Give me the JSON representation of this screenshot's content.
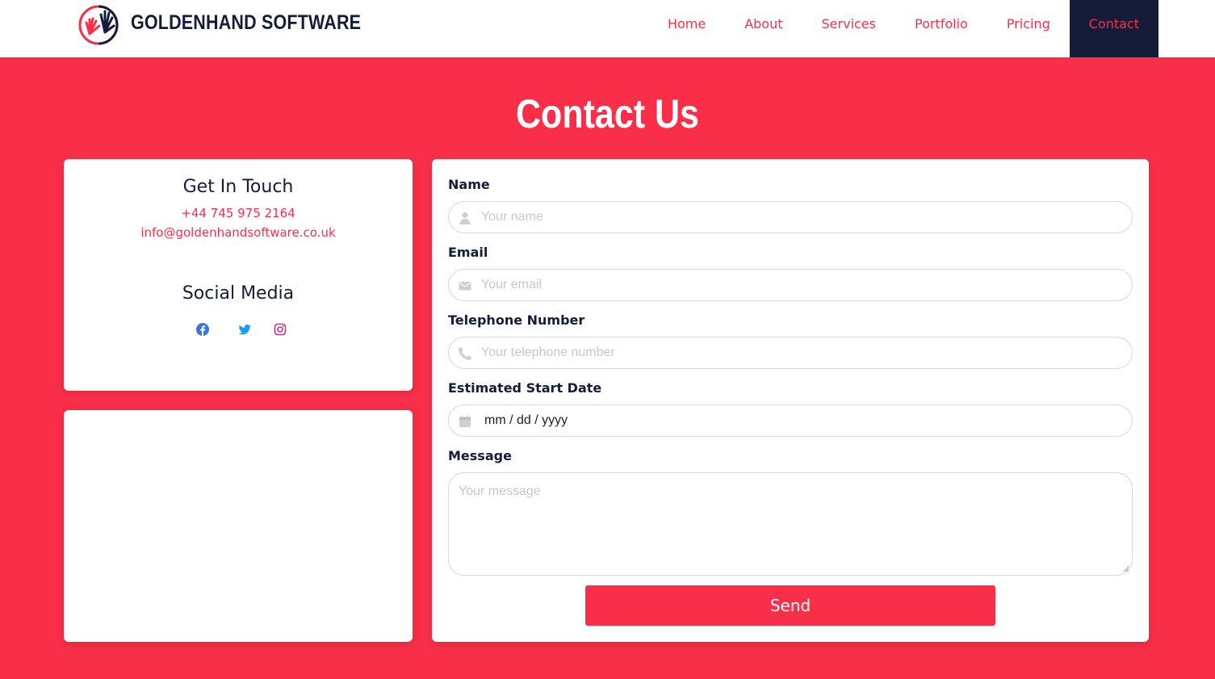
{
  "header": {
    "brand": "GOLDENHAND SOFTWARE",
    "nav": [
      {
        "label": "Home"
      },
      {
        "label": "About"
      },
      {
        "label": "Services"
      },
      {
        "label": "Portfolio"
      },
      {
        "label": "Pricing"
      },
      {
        "label": "Contact",
        "active": true
      }
    ]
  },
  "page": {
    "title": "Contact Us"
  },
  "contact_card": {
    "heading": "Get In Touch",
    "phone": "+44 745 975 2164",
    "email": "info@goldenhandsoftware.co.uk",
    "social_heading": "Social Media",
    "social_icons": [
      "facebook-icon",
      "twitter-icon",
      "instagram-icon"
    ]
  },
  "form": {
    "name": {
      "label": "Name",
      "placeholder": "Your name",
      "icon": "user-icon"
    },
    "email": {
      "label": "Email",
      "placeholder": "Your email",
      "icon": "envelope-icon"
    },
    "phone": {
      "label": "Telephone Number",
      "placeholder": "Your telephone number",
      "icon": "phone-icon"
    },
    "start_date": {
      "label": "Estimated Start Date",
      "value": "mm / dd / yyyy",
      "icon": "calendar-icon"
    },
    "message": {
      "label": "Message",
      "placeholder": "Your message"
    },
    "send_label": "Send"
  },
  "colors": {
    "accent": "#f92f49",
    "navy": "#141c3a",
    "facebook": "#3b73e6",
    "twitter": "#1d9bf0",
    "instagram": "#c13584"
  }
}
